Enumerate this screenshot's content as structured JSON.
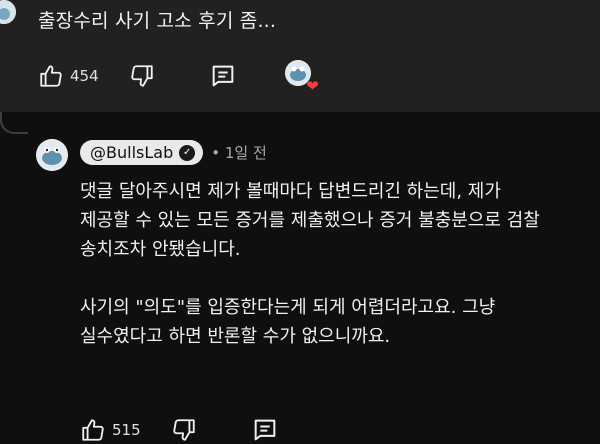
{
  "top_comment": {
    "text": "출장수리 사기 고소  후기 좀...",
    "like_count": "454"
  },
  "reply": {
    "handle": "@BullsLab",
    "timestamp": "1일 전",
    "paragraphs": [
      "댓글 달아주시면 제가 볼때마다 답변드리긴 하는데, 제가",
      "제공할 수 있는 모든 증거를 제출했으나 증거 불충분으로 검찰",
      "송치조차 안됐습니다.",
      "",
      "사기의 \"의도\"를 입증한다는게 되게 어렵더라고요. 그냥",
      "실수였다고 하면 반론할 수가 없으니까요."
    ],
    "like_count": "515"
  },
  "icons": [
    "thumbs-up-icon",
    "thumbs-down-icon",
    "reply-icon",
    "creator-heart-icon",
    "verified-check-icon"
  ],
  "colors": {
    "background": "#0f0f0f",
    "panel": "#212121",
    "heart": "#ff3b3b",
    "pill": "#e9e9e9"
  }
}
